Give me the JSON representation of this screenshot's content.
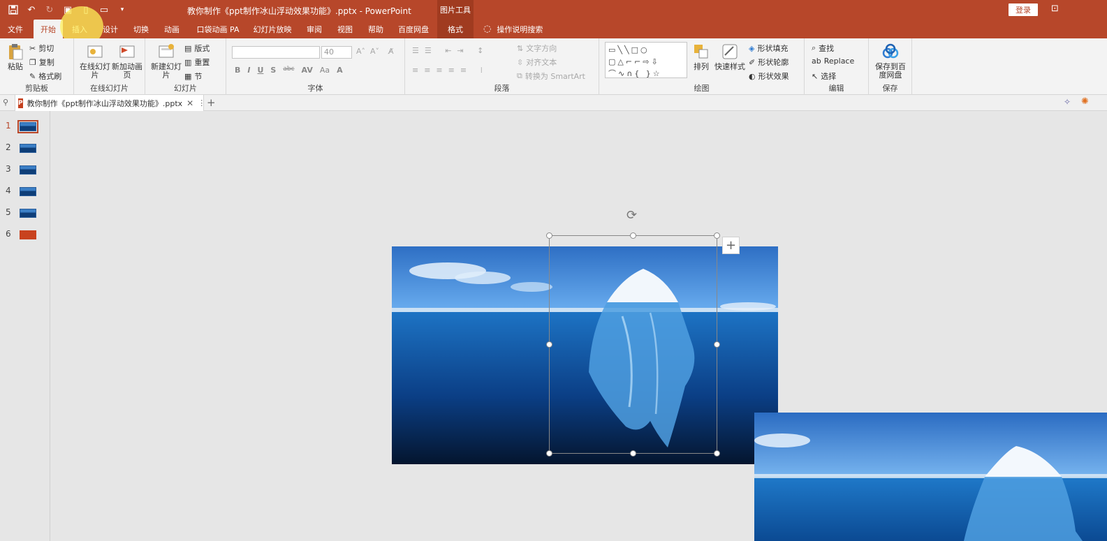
{
  "titlebar": {
    "doc_title": "教你制作《ppt制作冰山浮动效果功能》.pptx  -  PowerPoint",
    "context_title": "图片工具",
    "login": "登录"
  },
  "tabs": {
    "file": "文件",
    "home": "开始",
    "insert": "插入",
    "design": "设计",
    "transitions": "切换",
    "animations": "动画",
    "pocket_anim": "口袋动画 PA",
    "slideshow": "幻灯片放映",
    "review": "审阅",
    "view": "视图",
    "help": "帮助",
    "baidu": "百度网盘",
    "format": "格式",
    "tell_me": "操作说明搜索"
  },
  "ribbon": {
    "clipboard": {
      "label": "剪贴板",
      "paste": "粘贴",
      "cut": "剪切",
      "copy": "复制",
      "format_painter": "格式刷"
    },
    "online": {
      "label": "在线幻灯片",
      "online_slides": "在线幻灯片",
      "new_anim_page": "新加动画页"
    },
    "slides": {
      "label": "幻灯片",
      "new_slide": "新建幻灯片",
      "layout": "版式",
      "reset": "重置",
      "section": "节"
    },
    "font": {
      "label": "字体",
      "size": "40",
      "format_buttons": [
        "B",
        "I",
        "U",
        "S",
        "abc",
        "AV",
        "Aa",
        "A"
      ]
    },
    "paragraph": {
      "label": "段落",
      "text_direction": "文字方向",
      "align_text": "对齐文本",
      "to_smartart": "转换为 SmartArt"
    },
    "drawing": {
      "label": "绘图",
      "arrange": "排列",
      "quick_styles": "快速样式",
      "shape_fill": "形状填充",
      "shape_outline": "形状轮廓",
      "shape_effects": "形状效果"
    },
    "editing": {
      "label": "编辑",
      "find": "查找",
      "replace": "Replace",
      "select": "选择"
    },
    "save": {
      "label": "保存",
      "save_to_baidu": "保存到百度网盘"
    }
  },
  "doc_tab": {
    "name": "教你制作《ppt制作冰山浮动效果功能》.pptx"
  },
  "thumbnails": [
    {
      "num": "1",
      "selected": true,
      "style": "blue"
    },
    {
      "num": "2",
      "selected": false,
      "style": "blue"
    },
    {
      "num": "3",
      "selected": false,
      "style": "blue"
    },
    {
      "num": "4",
      "selected": false,
      "style": "blue"
    },
    {
      "num": "5",
      "selected": false,
      "style": "blue"
    },
    {
      "num": "6",
      "selected": false,
      "style": "red"
    }
  ],
  "colors": {
    "accent": "#b7472a",
    "ribbon_bg": "#f3f3f3",
    "canvas_bg": "#e6e6e6"
  }
}
